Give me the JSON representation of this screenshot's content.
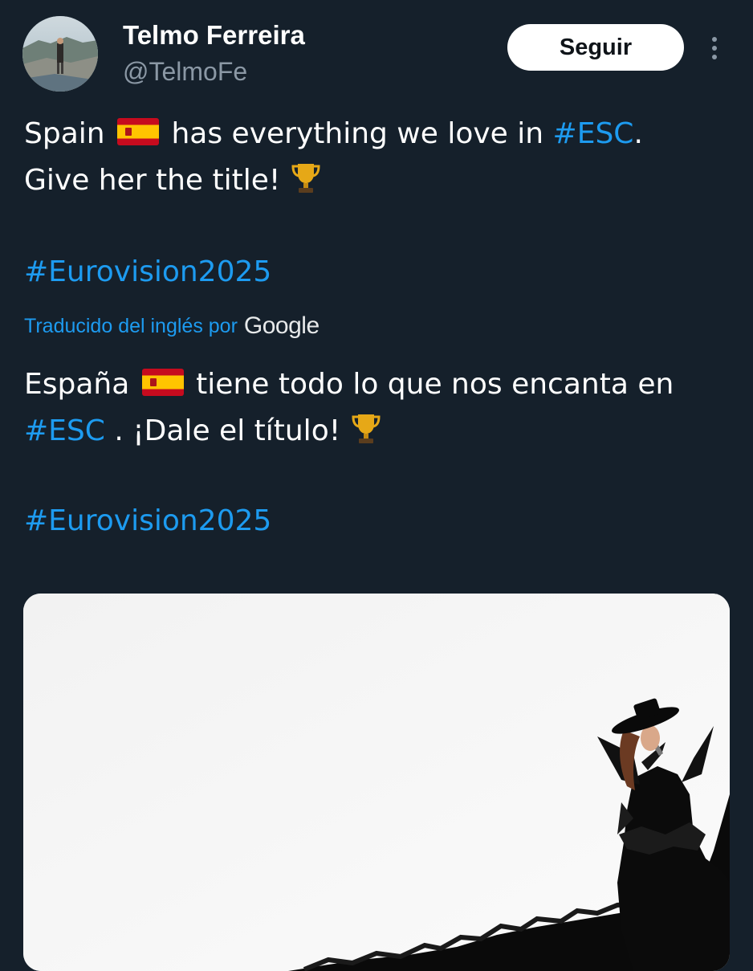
{
  "author": {
    "name": "Telmo Ferreira",
    "handle": "@TelmoFe"
  },
  "actions": {
    "follow_label": "Seguir",
    "more_icon": "more-vertical-icon"
  },
  "tweet": {
    "line1_pre": "Spain ",
    "line1_mid": " has everything we love in ",
    "line1_hashtag": "#ESC",
    "line1_post": ".",
    "line2": "Give her the title! ",
    "hashtag": "#Eurovision2025"
  },
  "translation": {
    "label": "Traducido del inglés por",
    "provider": "Google",
    "line1_pre": "España ",
    "line1_post": " tiene todo lo que nos encanta en",
    "line2_hashtag": "#ESC",
    "line2_post": " . ¡Dale el título! ",
    "hashtag": "#Eurovision2025"
  },
  "icons": {
    "flag": "spain-flag-emoji",
    "trophy": "trophy-emoji"
  },
  "colors": {
    "background": "#15202b",
    "link": "#1d9bf0",
    "secondary_text": "#8b98a5",
    "follow_button_bg": "#ffffff"
  }
}
